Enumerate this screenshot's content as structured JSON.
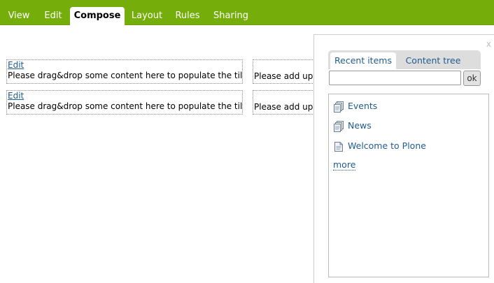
{
  "toolbar": {
    "tabs": [
      {
        "label": "View",
        "active": false
      },
      {
        "label": "Edit",
        "active": false
      },
      {
        "label": "Compose",
        "active": true
      },
      {
        "label": "Layout",
        "active": false
      },
      {
        "label": "Rules",
        "active": false
      },
      {
        "label": "Sharing",
        "active": false
      }
    ],
    "background_color": "#75ad0a"
  },
  "tiles": [
    {
      "edit_label": "Edit",
      "message": "Please drag&drop some content here to populate the tile."
    },
    {
      "edit_label": "Edit",
      "message": "Please drag&drop some content here to populate the tile."
    },
    {
      "message": "Please add up"
    },
    {
      "message": "Please add up"
    }
  ],
  "panel": {
    "close_label": "x",
    "tabs": [
      {
        "label": "Recent items",
        "active": true
      },
      {
        "label": "Content tree",
        "active": false
      }
    ],
    "search": {
      "value": "",
      "placeholder": ""
    },
    "ok_label": "ok",
    "results": [
      {
        "label": "Events",
        "icon": "folder-icon"
      },
      {
        "label": "News",
        "icon": "folder-icon"
      },
      {
        "label": "Welcome to Plone",
        "icon": "document-icon"
      }
    ],
    "more_label": "more",
    "link_color": "#205c90"
  }
}
